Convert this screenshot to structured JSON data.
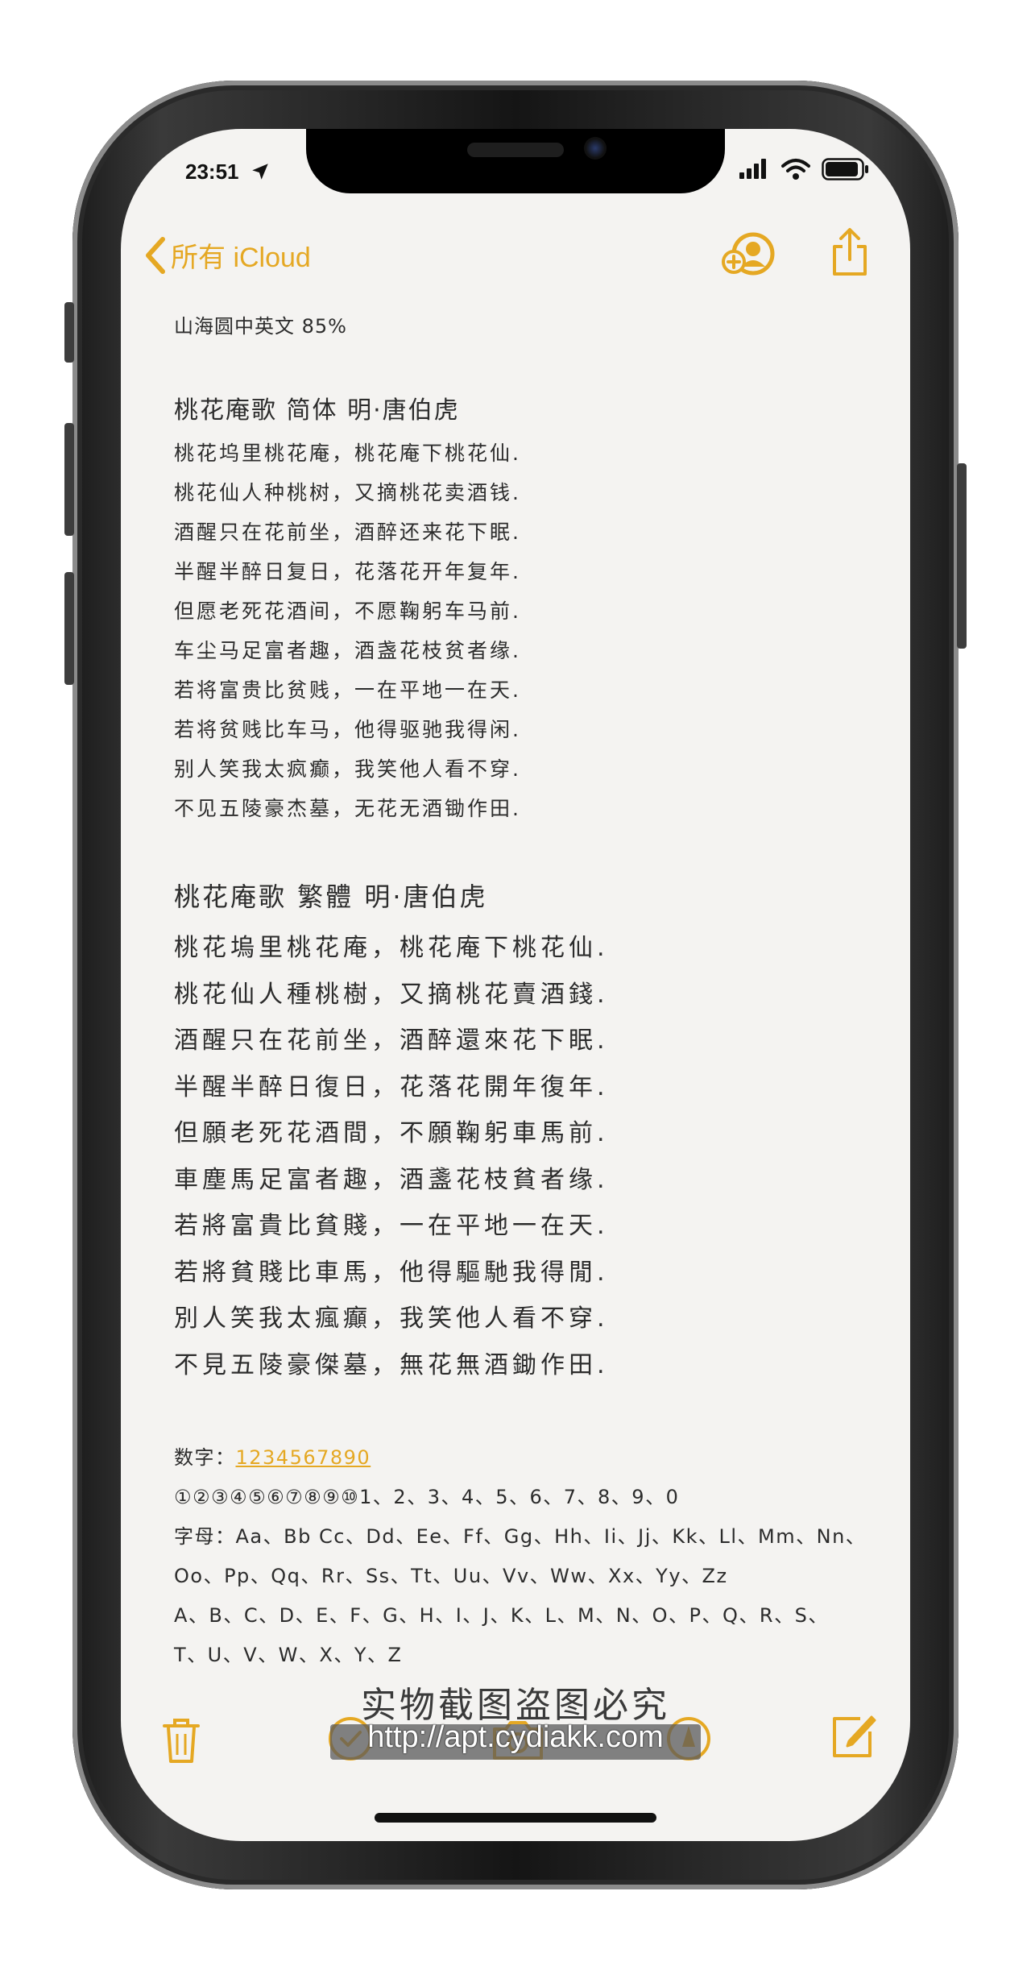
{
  "status_bar": {
    "time": "23:51"
  },
  "nav": {
    "back_label": "所有 iCloud"
  },
  "note": {
    "header": "山海圆中英文 85%",
    "poem_simplified": {
      "title": "桃花庵歌 简体  明·唐伯虎",
      "lines": [
        "桃花坞里桃花庵，桃花庵下桃花仙.",
        "桃花仙人种桃树，又摘桃花卖酒钱.",
        "酒醒只在花前坐，酒醉还来花下眠.",
        "半醒半醉日复日，花落花开年复年.",
        "但愿老死花酒间，不愿鞠躬车马前.",
        "车尘马足富者趣，酒盏花枝贫者缘.",
        "若将富贵比贫贱，一在平地一在天.",
        "若将贫贱比车马，他得驱驰我得闲.",
        "别人笑我太疯癫，我笑他人看不穿.",
        "不见五陵豪杰墓，无花无酒锄作田."
      ]
    },
    "poem_traditional": {
      "title": "桃花庵歌 繁體   明·唐伯虎",
      "lines": [
        "桃花塢里桃花庵，桃花庵下桃花仙.",
        "桃花仙人種桃樹，又摘桃花賣酒錢.",
        "酒醒只在花前坐，酒醉還來花下眠.",
        "半醒半醉日復日，花落花開年復年.",
        "但願老死花酒間，不願鞠躬車馬前.",
        "車塵馬足富者趣，酒盞花枝貧者缘.",
        "若將富貴比貧賤，一在平地一在天.",
        "若將貧賤比車馬，他得驅馳我得閒.",
        "別人笑我太瘋癲，我笑他人看不穿.",
        "不見五陵豪傑墓，無花無酒鋤作田."
      ]
    },
    "digits_label": "数字：",
    "digits_link": "1234567890",
    "extra_lines": [
      "①②③④⑤⑥⑦⑧⑨⑩1、2、3、4、5、6、7、8、9、0",
      "字母：Aa、Bb Cc、Dd、Ee、Ff、Gg、Hh、Ii、Jj、Kk、Ll、Mm、Nn、",
      "Oo、Pp、Qq、Rr、Ss、Tt、Uu、Vv、Ww、Xx、Yy、Zz",
      "A、B、C、D、E、F、G、H、I、J、K、L、M、N、O、P、Q、R、S、",
      "T、U、V、W、X、Y、Z"
    ]
  },
  "watermark": {
    "line1": "实物截图盗图必究",
    "line2": "http://apt.cydiakk.com"
  },
  "colors": {
    "accent": "#e5a823",
    "text": "#2c2c2c",
    "paper": "#f4f3f1"
  },
  "icons": {
    "back": "chevron-left-icon",
    "share_contact": "add-person-icon",
    "share": "share-icon",
    "trash": "trash-icon",
    "checklist": "checklist-icon",
    "camera": "camera-icon",
    "markup": "markup-icon",
    "compose": "compose-icon"
  }
}
